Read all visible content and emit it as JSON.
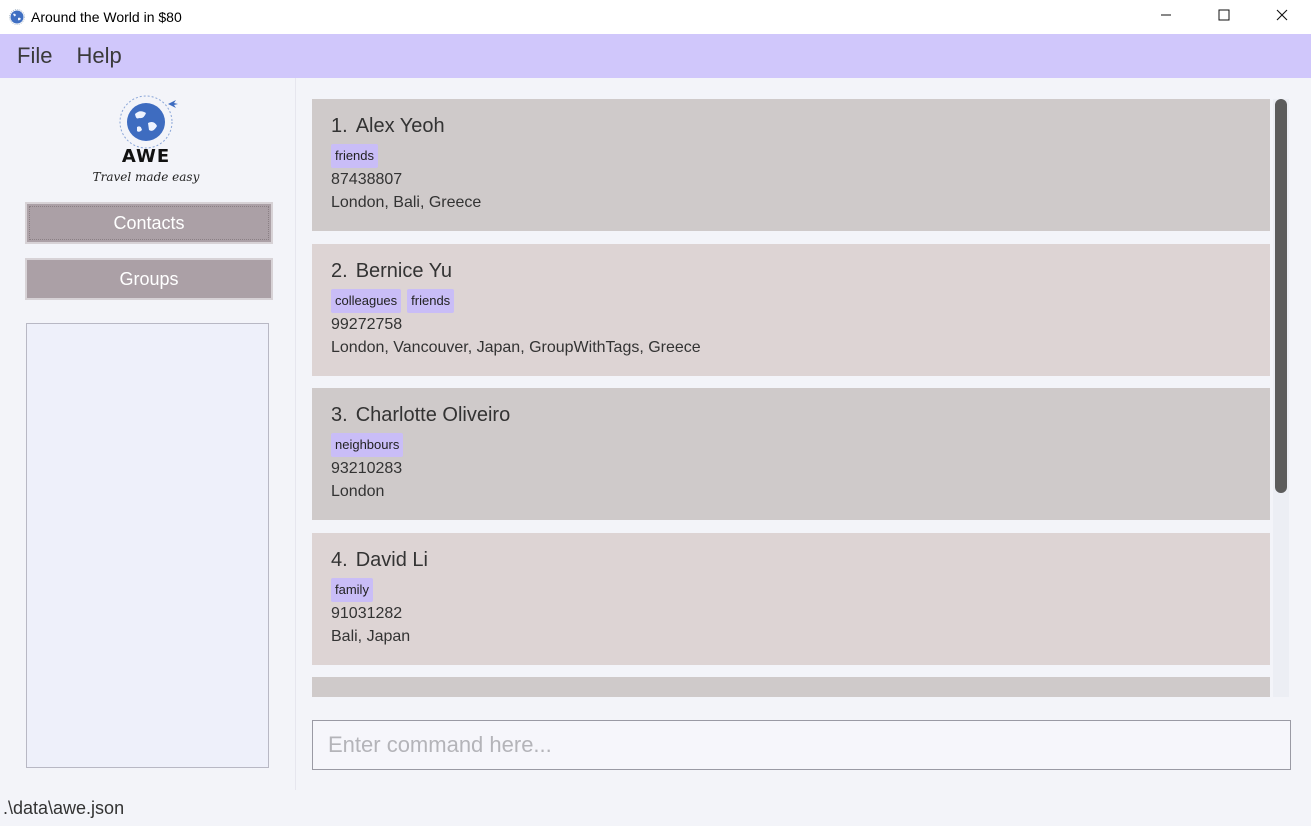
{
  "window": {
    "title": "Around the World in $80",
    "controls": [
      "minimize-icon",
      "maximize-icon",
      "close-icon"
    ]
  },
  "menu": {
    "items": [
      {
        "label": "File"
      },
      {
        "label": "Help"
      }
    ]
  },
  "sidebar": {
    "logo": {
      "title": "AWE",
      "tagline": "Travel made easy"
    },
    "buttons": [
      {
        "label": "Contacts"
      },
      {
        "label": "Groups"
      }
    ]
  },
  "contacts": [
    {
      "index": "1.",
      "name": "Alex Yeoh",
      "tags": [
        "friends"
      ],
      "phone": "87438807",
      "groups": "London, Bali, Greece"
    },
    {
      "index": "2.",
      "name": "Bernice Yu",
      "tags": [
        "colleagues",
        "friends"
      ],
      "phone": "99272758",
      "groups": "London, Vancouver, Japan, GroupWithTags, Greece"
    },
    {
      "index": "3.",
      "name": "Charlotte Oliveiro",
      "tags": [
        "neighbours"
      ],
      "phone": "93210283",
      "groups": "London"
    },
    {
      "index": "4.",
      "name": "David Li",
      "tags": [
        "family"
      ],
      "phone": "91031282",
      "groups": "Bali, Japan"
    }
  ],
  "command": {
    "placeholder": "Enter command here...",
    "value": ""
  },
  "status": {
    "path": ".\\data\\awe.json"
  },
  "colors": {
    "menubar": "#d0c7fb",
    "tag": "#c9bdf7",
    "sidebar_button": "#aba0a6",
    "card_odd": "#cfcaca",
    "card_even": "#ddd4d4"
  }
}
